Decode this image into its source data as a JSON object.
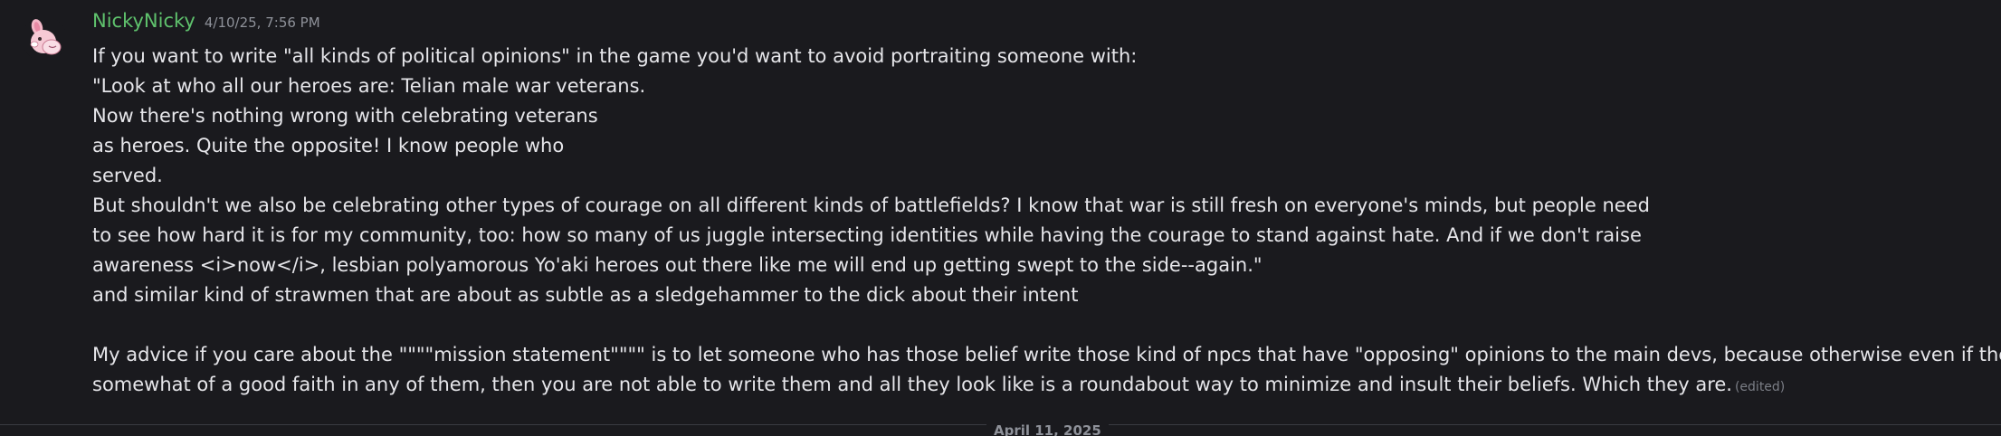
{
  "message": {
    "username": "NickyNicky",
    "timestamp": "4/10/25, 7:56 PM",
    "lines": [
      "If you want to write \"all kinds of political opinions\" in the game you'd want to avoid portraiting someone with:",
      "\"Look at who all our heroes are: Telian male war veterans.",
      "Now there's nothing wrong with celebrating veterans",
      "as heroes. Quite the opposite! I know people who",
      "served.",
      "But shouldn't we also be celebrating other types of courage on all different kinds of battlefields? I know that war is still fresh on everyone's minds, but people need",
      "to see how hard it is for my community, too: how so many of us juggle intersecting identities while having the courage to stand against hate. And if we don't raise",
      "awareness <i>now</i>, lesbian polyamorous Yo'aki heroes out there like me will end up getting swept to the side--again.\"",
      "and similar kind of strawmen that are about as subtle as a sledgehammer to the dick about their intent",
      "",
      "My advice if you care about the \"\"\"\"mission statement\"\"\"\" is to let someone who has those belief write those kind of npcs that have \"opposing\" opinions to the main devs, because otherwise even if there is",
      "somewhat of a good faith in any of them, then you are not able to write them and all they look like is a roundabout way to minimize and insult their beliefs. Which they are."
    ],
    "edited_label": "(edited)",
    "avatar_icon": "pink-bunny-avatar"
  },
  "date_divider": "April 11, 2025",
  "colors": {
    "background": "#1a1a1e",
    "username": "#5fc26d",
    "text": "#e6e6ea",
    "muted": "#8e9199"
  }
}
